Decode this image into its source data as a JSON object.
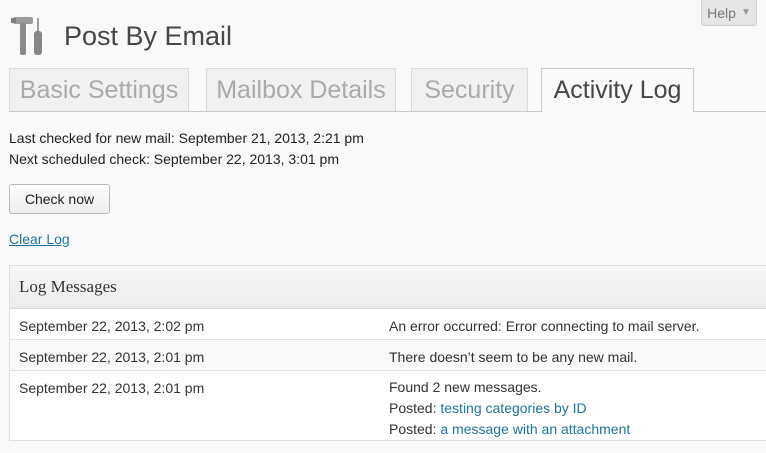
{
  "help": {
    "label": "Help",
    "arrow": "▼"
  },
  "app": {
    "title": "Post By Email",
    "icon": "tools-icon"
  },
  "tabs": [
    {
      "label": "Basic Settings",
      "active": false
    },
    {
      "label": "Mailbox Details",
      "active": false
    },
    {
      "label": "Security",
      "active": false
    },
    {
      "label": "Activity Log",
      "active": true
    }
  ],
  "status": {
    "last_checked": "Last checked for new mail: September 21, 2013, 2:21 pm",
    "next_check": "Next scheduled check: September 22, 2013, 3:01 pm"
  },
  "actions": {
    "check_now": "Check now",
    "clear_log": "Clear Log"
  },
  "log": {
    "title": "Log Messages",
    "rows": [
      {
        "date": "September 22, 2013, 2:02 pm",
        "message": "An error occurred: Error connecting to mail server."
      },
      {
        "date": "September 22, 2013, 2:01 pm",
        "message": "There doesn’t seem to be any new mail."
      },
      {
        "date": "September 22, 2013, 2:01 pm",
        "message": "Found 2 new messages.",
        "posted": [
          {
            "prefix": "Posted:",
            "link": "testing categories by ID"
          },
          {
            "prefix": "Posted:",
            "link": "a message with an attachment"
          }
        ]
      }
    ]
  },
  "colors": {
    "link": "#21759b",
    "background": "#f9f9f9"
  }
}
